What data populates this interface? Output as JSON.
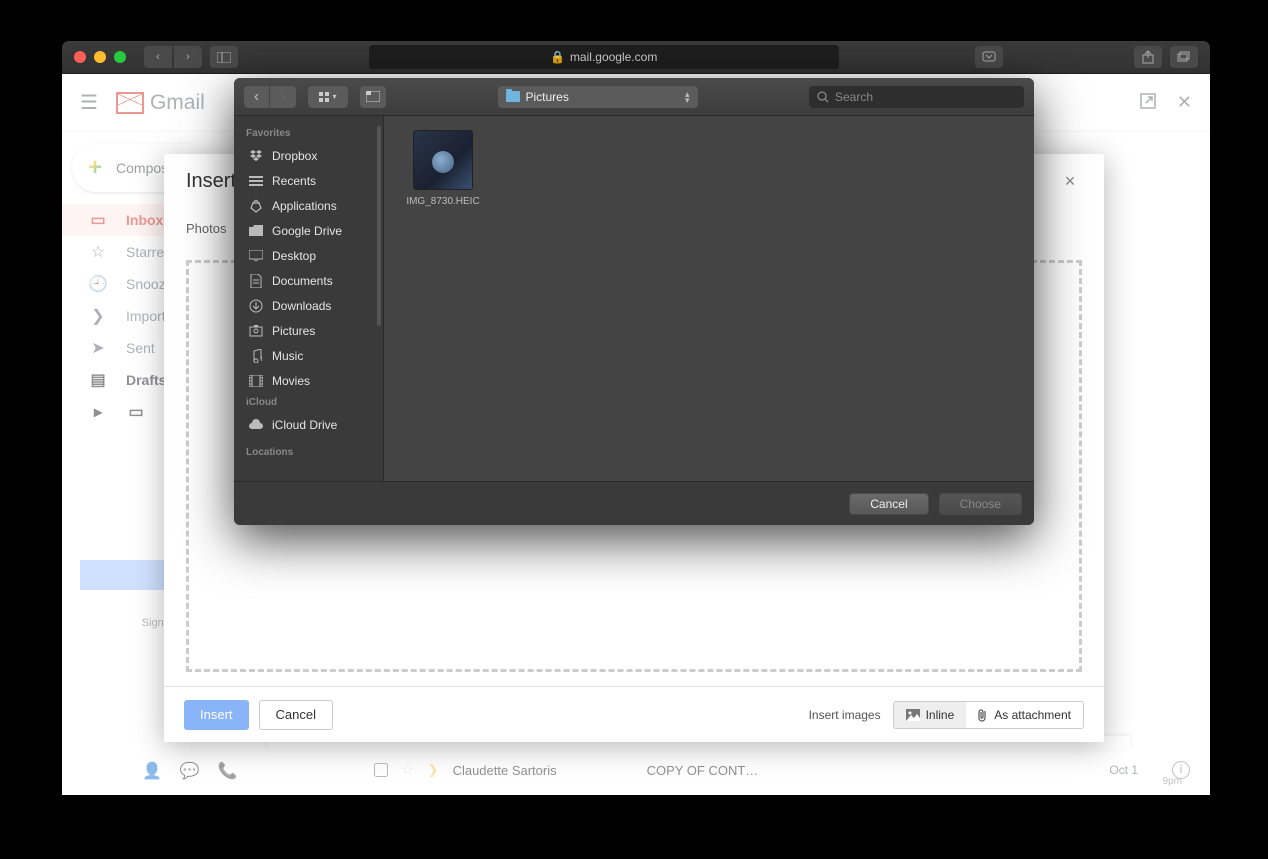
{
  "safari": {
    "url_host": "mail.google.com",
    "lock_icon": "🔒"
  },
  "gmail": {
    "brand": "Gmail",
    "compose": "Compose",
    "nav": {
      "inbox": "Inbox",
      "starred": "Starred",
      "snoozed": "Snoozed",
      "important": "Important",
      "sent": "Sent",
      "drafts": "Drafts",
      "categories": "Categories"
    },
    "signing_note": "Signing in will ac L",
    "mail_row": {
      "sender": "Claudette Sartoris",
      "subject": "COPY OF CONT…",
      "date": "Oct 1"
    },
    "calendar_time": "9pm"
  },
  "insert_modal": {
    "title": "Insert",
    "tabs": {
      "photos": "Photos"
    },
    "close": "×",
    "buttons": {
      "insert": "Insert",
      "cancel": "Cancel"
    },
    "right_label": "Insert images",
    "seg_inline": "Inline",
    "seg_attachment": "As attachment"
  },
  "finder": {
    "folder_selected": "Pictures",
    "search_placeholder": "Search",
    "sidebar": {
      "favorites_header": "Favorites",
      "icloud_header": "iCloud",
      "locations_header": "Locations",
      "favorites": [
        "Dropbox",
        "Recents",
        "Applications",
        "Google Drive",
        "Desktop",
        "Documents",
        "Downloads",
        "Pictures",
        "Music",
        "Movies"
      ],
      "icloud": [
        "iCloud Drive"
      ]
    },
    "files": [
      {
        "name": "IMG_8730.HEIC"
      }
    ],
    "buttons": {
      "cancel": "Cancel",
      "choose": "Choose"
    }
  }
}
